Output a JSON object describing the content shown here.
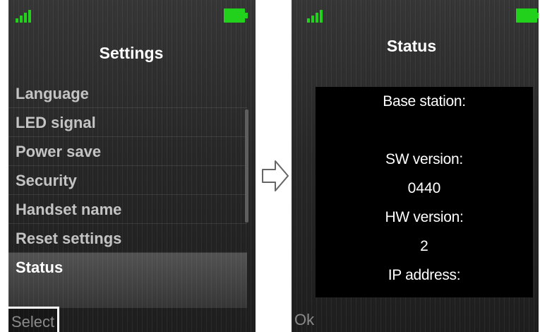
{
  "colors": {
    "signal": "#22d11c",
    "battery": "#22d11c",
    "menu_text": "#c4c4c4",
    "selected_text": "#ffffff",
    "panel": "#000000"
  },
  "left_screen": {
    "title": "Settings",
    "menu_items": [
      {
        "label": "Language"
      },
      {
        "label": "LED signal"
      },
      {
        "label": "Power save"
      },
      {
        "label": "Security"
      },
      {
        "label": "Handset name"
      },
      {
        "label": "Reset settings"
      },
      {
        "label": "Status",
        "selected": true
      }
    ],
    "softkey": "Select"
  },
  "arrow_icon": "right-arrow-icon",
  "right_screen": {
    "title": "Status",
    "lines": [
      {
        "text": "Base station:"
      },
      {
        "text": ""
      },
      {
        "text": "SW version:"
      },
      {
        "text": "0440"
      },
      {
        "text": "HW version:"
      },
      {
        "text": "2"
      },
      {
        "text": "IP address:"
      }
    ],
    "softkey": "Ok"
  }
}
